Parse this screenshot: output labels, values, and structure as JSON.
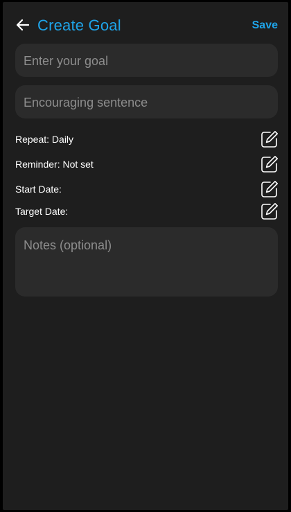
{
  "header": {
    "title": "Create Goal",
    "save_label": "Save",
    "back_icon": "arrow-left-icon"
  },
  "form": {
    "goal_placeholder": "Enter your goal",
    "goal_value": "",
    "encouraging_placeholder": "Encouraging sentence",
    "encouraging_value": "",
    "notes_placeholder": "Notes (optional)",
    "notes_value": ""
  },
  "settings": {
    "repeat": "Repeat: Daily",
    "reminder": "Reminder: Not set",
    "start_date": "Start Date:",
    "target_date": "Target Date:",
    "edit_icon": "edit-icon"
  },
  "colors": {
    "accent": "#1ea4e9",
    "background": "#1e1e1e",
    "field": "#2b2b2b",
    "placeholder": "#8d8d8d",
    "text": "#ffffff"
  }
}
